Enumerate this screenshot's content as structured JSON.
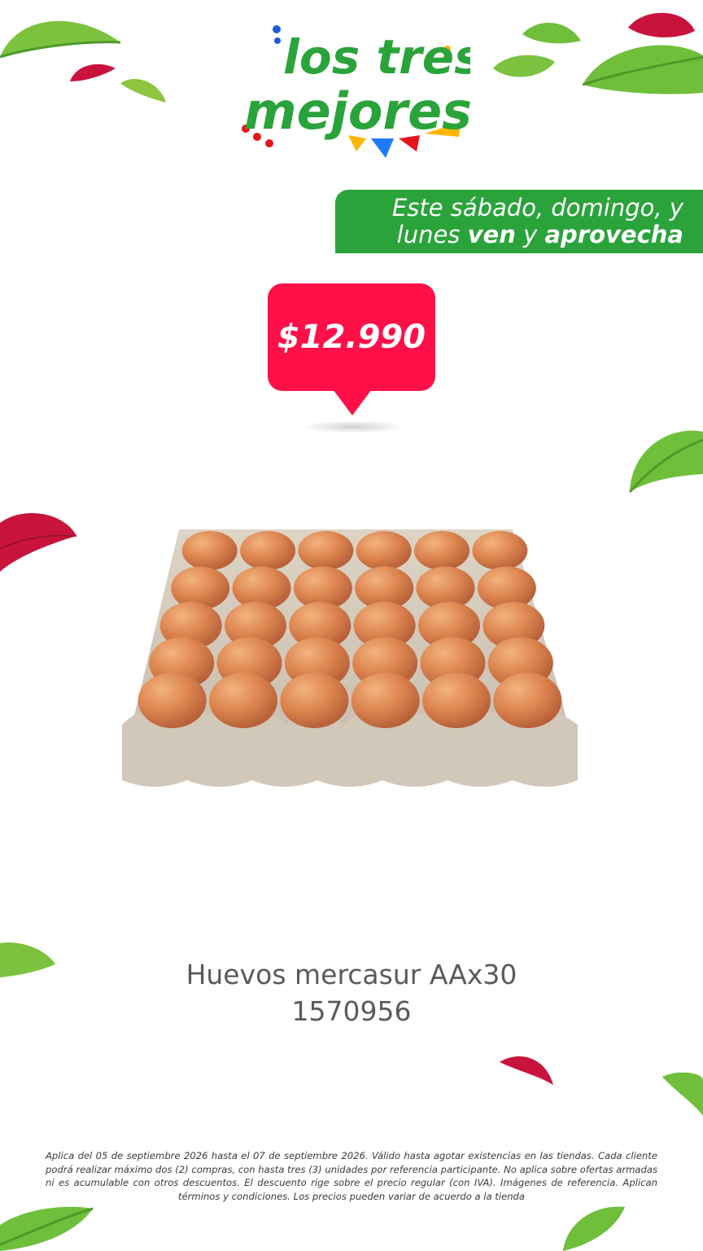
{
  "brand": {
    "logo_line1": "los tres",
    "logo_line2": "mejores"
  },
  "promo_banner": {
    "line1": "Este sábado, domingo, y",
    "line2_prefix": "lunes ",
    "line2_bold1": "ven",
    "line2_mid": " y ",
    "line2_bold2": "aprovecha"
  },
  "price": {
    "label": "$12.990"
  },
  "product": {
    "name": "Huevos mercasur AAx30",
    "code": "1570956"
  },
  "disclaimer": {
    "text": "Aplica del 05 de septiembre 2026 hasta el 07 de septiembre 2026. Válido hasta agotar existencias en las tiendas. Cada cliente podrá realizar máximo dos (2) compras, con hasta tres (3) unidades por referencia participante. No aplica sobre ofertas armadas ni es acumulable con otros descuentos. El descuento rige sobre el precio regular (con IVA). Imágenes de referencia. Aplican términos y condiciones. Los precios pueden variar de acuerdo a la tienda"
  },
  "colors": {
    "brand_green": "#2aa33b",
    "price_red": "#ff1048",
    "leaf_green": "#7cc23f",
    "leaf_red": "#c8143c"
  },
  "icons": [
    "leaf-green-icon",
    "leaf-red-icon",
    "price-tag-icon"
  ]
}
